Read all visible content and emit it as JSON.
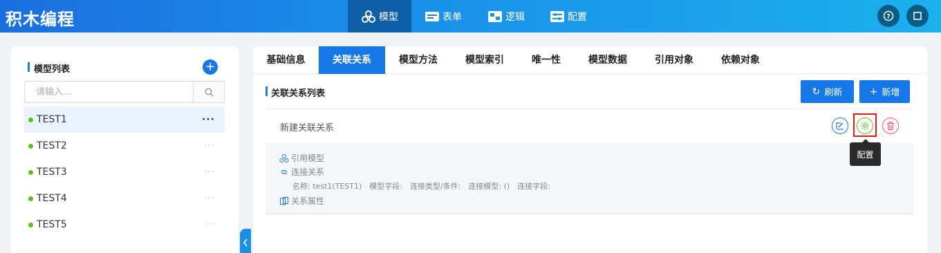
{
  "app": {
    "title": "积木编程"
  },
  "nav": {
    "items": [
      {
        "label": "模型",
        "icon": "model-icon",
        "active": true
      },
      {
        "label": "表单",
        "icon": "form-icon",
        "active": false
      },
      {
        "label": "逻辑",
        "icon": "logic-icon",
        "active": false
      },
      {
        "label": "配置",
        "icon": "config-icon",
        "active": false
      }
    ]
  },
  "left": {
    "title": "模型列表",
    "search_placeholder": "请输入...",
    "items": [
      {
        "label": "TEST1",
        "active": true
      },
      {
        "label": "TEST2",
        "active": false
      },
      {
        "label": "TEST3",
        "active": false
      },
      {
        "label": "TEST4",
        "active": false
      },
      {
        "label": "TEST5",
        "active": false
      }
    ],
    "more": "···"
  },
  "tabs": [
    "基础信息",
    "关联关系",
    "模型方法",
    "模型索引",
    "唯一性",
    "模型数据",
    "引用对象",
    "依赖对象"
  ],
  "active_tab": "关联关系",
  "main": {
    "section_title": "关联关系列表",
    "refresh_label": "刷新",
    "add_label": "新增",
    "relation_name": "新建关联关系",
    "tooltip": "配置",
    "ref_model_label": "引用模型",
    "connect_label": "连接关系",
    "fields": {
      "name": "名称: test1(TEST1)",
      "model_field": "模型字段:",
      "connect_type": "连接类型/条件:",
      "connect_model": "连接模型: ()",
      "connect_field": "连接字段:"
    },
    "props_label": "关系属性"
  },
  "colors": {
    "primary": "#1677e8",
    "success": "#52c41a",
    "danger": "#f5576c",
    "highlight": "#e81616"
  }
}
